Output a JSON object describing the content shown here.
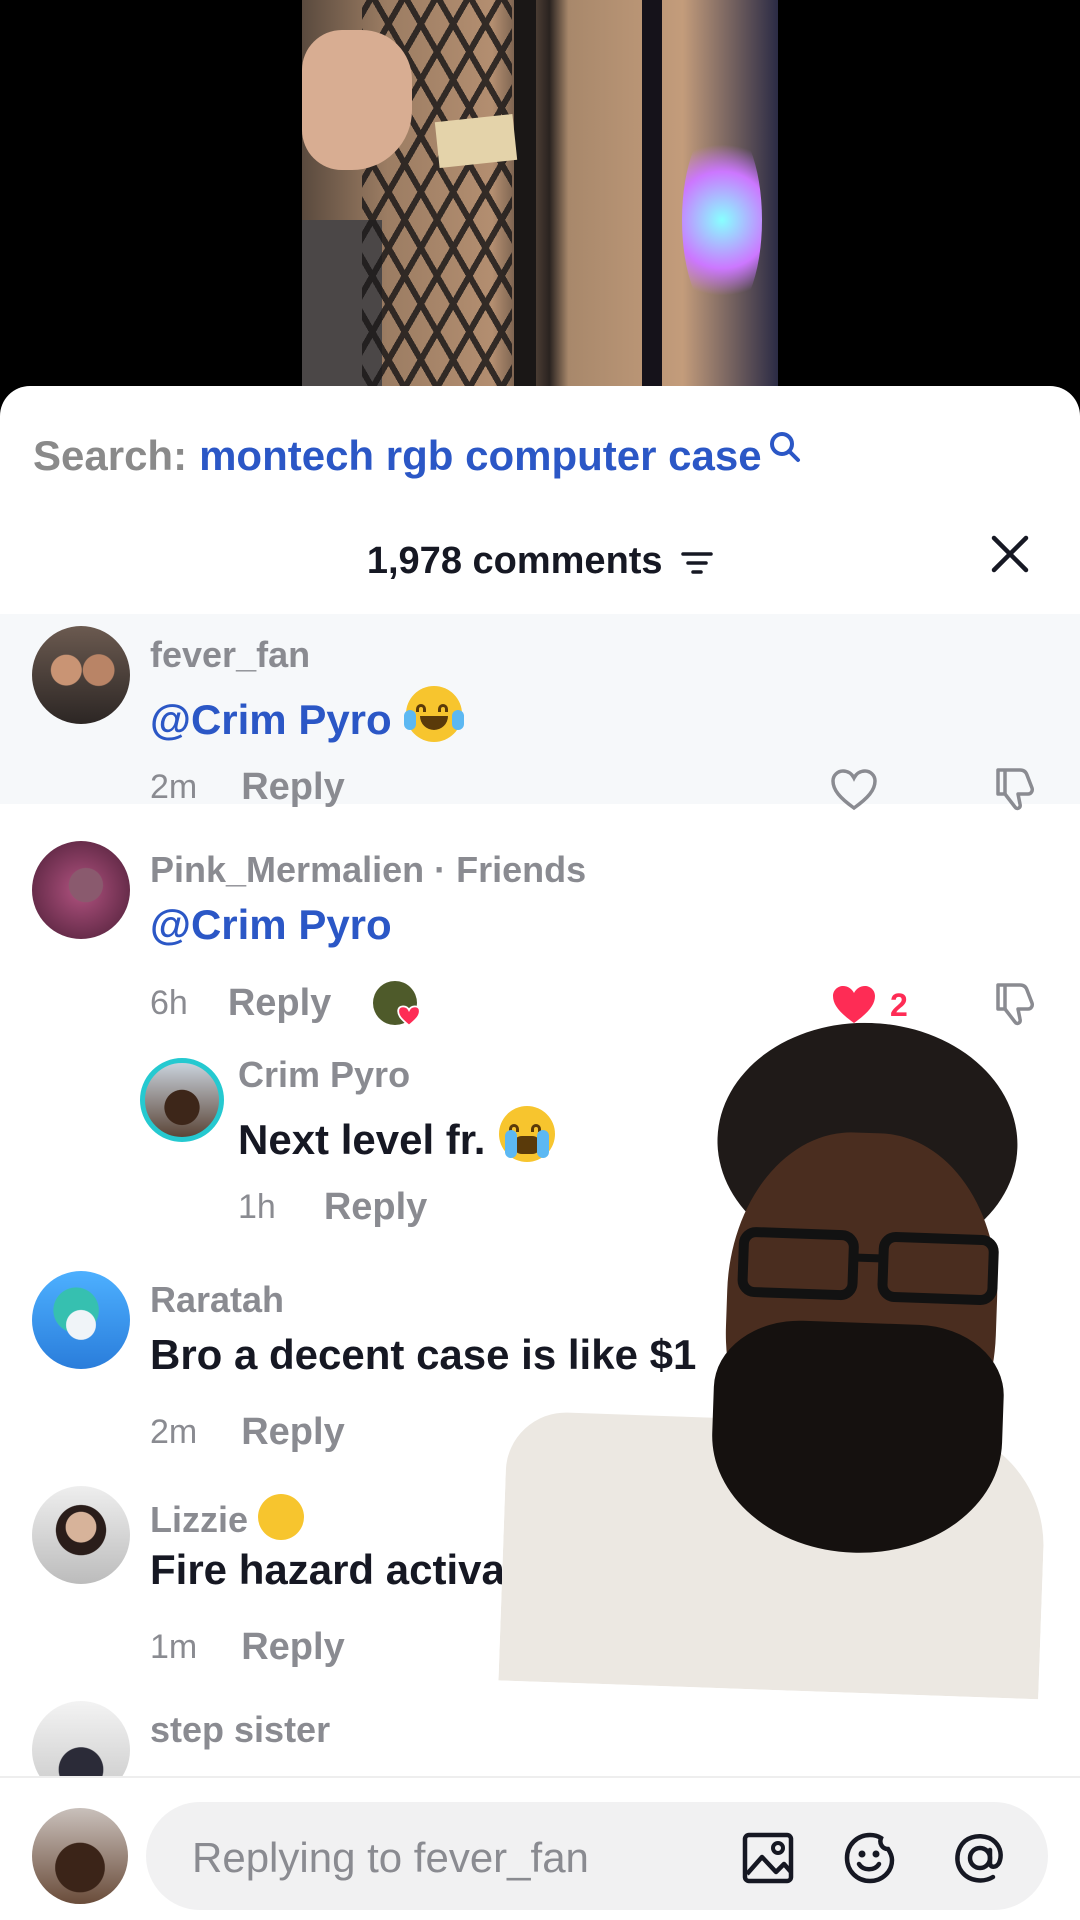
{
  "search": {
    "label": "Search:",
    "term": "montech rgb computer case"
  },
  "header": {
    "count": "1,978 comments"
  },
  "comments": [
    {
      "username": "fever_fan",
      "mention": "@Crim Pyro",
      "time": "2m",
      "reply": "Reply"
    },
    {
      "username": "Pink_Mermalien · Friends",
      "mention": "@Crim Pyro",
      "time": "6h",
      "reply": "Reply",
      "likes": "2"
    },
    {
      "username": "Crim Pyro",
      "text": "Next level fr.",
      "time": "1h",
      "reply": "Reply"
    },
    {
      "username": "Raratah",
      "text": "Bro a decent case is like $1",
      "time": "2m",
      "reply": "Reply"
    },
    {
      "username": "Lizzie",
      "text": "Fire hazard activa",
      "time": "1m",
      "reply": "Reply"
    },
    {
      "username": "step sister"
    }
  ],
  "reply_bar": {
    "placeholder": "Replying to fever_fan"
  },
  "icons": {
    "search": "search-icon",
    "sort": "sort-icon",
    "close": "close-icon",
    "like": "heart-icon",
    "dislike": "dislike-icon",
    "image": "image-icon",
    "emoji": "emoji-icon",
    "mention": "at-icon"
  },
  "colors": {
    "accent": "#2b57c6",
    "like": "#fe2c55",
    "text": "#161823",
    "muted": "#8a8b91"
  }
}
